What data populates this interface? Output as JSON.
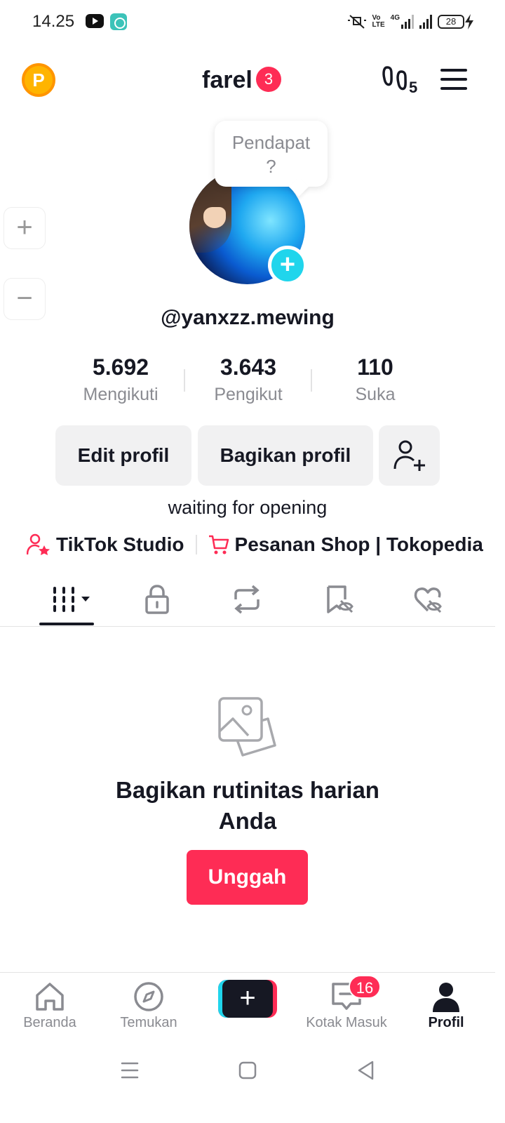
{
  "status_bar": {
    "time": "14.25",
    "network_volte": "Vo\nLTE",
    "network_type": "4G",
    "battery": "28"
  },
  "header": {
    "coin_letter": "P",
    "username": "farel",
    "notification_count": "3",
    "profile_views_count": "5"
  },
  "zoom": {
    "plus": "+",
    "minus": "−"
  },
  "profile": {
    "tooltip": "Pendapat\n?",
    "handle": "@yanxzz.mewing",
    "stats": [
      {
        "value": "5.692",
        "label": "Mengikuti"
      },
      {
        "value": "3.643",
        "label": "Pengikut"
      },
      {
        "value": "110",
        "label": "Suka"
      }
    ],
    "edit_button": "Edit profil",
    "share_button": "Bagikan profil",
    "bio": "waiting for opening",
    "links": [
      {
        "label": "TikTok Studio",
        "icon": "person-star-icon"
      },
      {
        "label": "Pesanan Shop | Tokopedia",
        "icon": "cart-icon"
      }
    ]
  },
  "tabs": [
    {
      "name": "videos-grid",
      "icon": "grid-icon",
      "active": true
    },
    {
      "name": "private",
      "icon": "lock-icon",
      "active": false
    },
    {
      "name": "reposts",
      "icon": "repost-icon",
      "active": false
    },
    {
      "name": "favorites",
      "icon": "bookmark-hidden-icon",
      "active": false
    },
    {
      "name": "liked",
      "icon": "heart-hidden-icon",
      "active": false
    }
  ],
  "empty_state": {
    "title": "Bagikan rutinitas harian Anda",
    "button": "Unggah"
  },
  "bottom_nav": {
    "items": [
      {
        "label": "Beranda",
        "icon": "home-icon"
      },
      {
        "label": "Temukan",
        "icon": "compass-icon"
      },
      {
        "label": "Kotak Masuk",
        "icon": "inbox-icon"
      },
      {
        "label": "Profil",
        "icon": "person-icon"
      }
    ],
    "create_label": "+",
    "inbox_badge": "16"
  },
  "colors": {
    "accent": "#fe2c55",
    "cyan": "#20d5ec",
    "text": "#161823",
    "muted": "#8a8b91",
    "button_bg": "#f1f1f2"
  }
}
